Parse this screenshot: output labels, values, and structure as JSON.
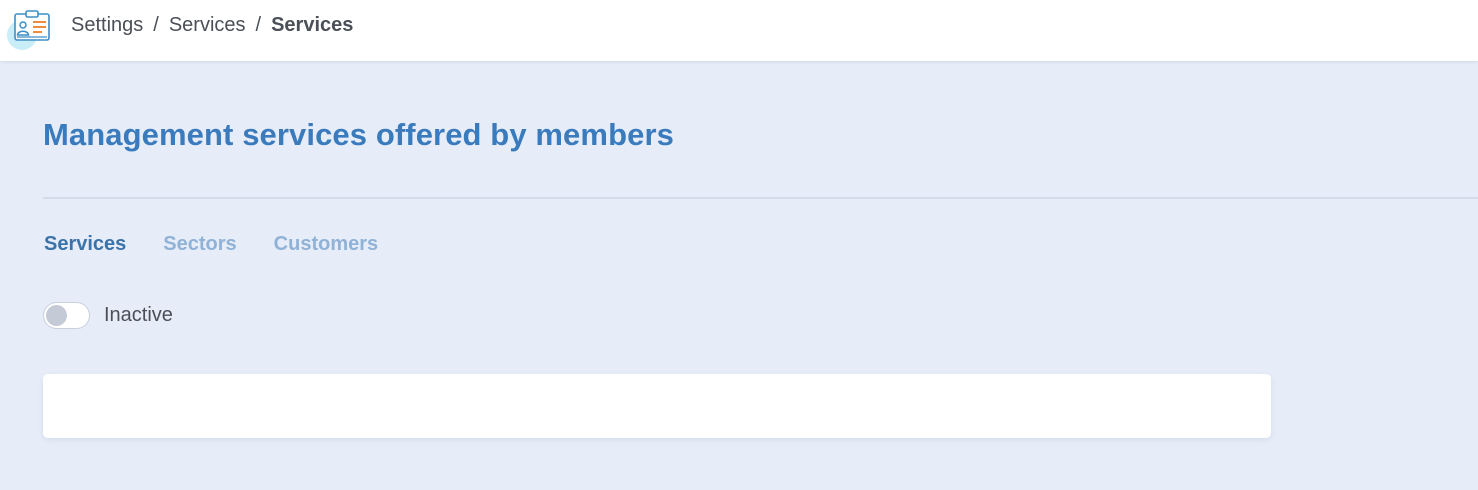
{
  "header": {
    "app_icon": "clipboard-id-card-icon",
    "breadcrumb": [
      {
        "label": "Settings"
      },
      {
        "label": "Services"
      },
      {
        "label": "Services"
      }
    ],
    "separator": "/"
  },
  "main": {
    "title": "Management services offered by members",
    "tabs": [
      {
        "label": "Services",
        "active": true
      },
      {
        "label": "Sectors",
        "active": false
      },
      {
        "label": "Customers",
        "active": false
      }
    ],
    "toggle": {
      "label": "Inactive",
      "on": false
    }
  },
  "colors": {
    "background": "#e7edf8",
    "title": "#3a7bbd",
    "tab_active": "#3a73aa",
    "tab_inactive": "#90b2d6",
    "icon_accent": "#f08a3c"
  }
}
